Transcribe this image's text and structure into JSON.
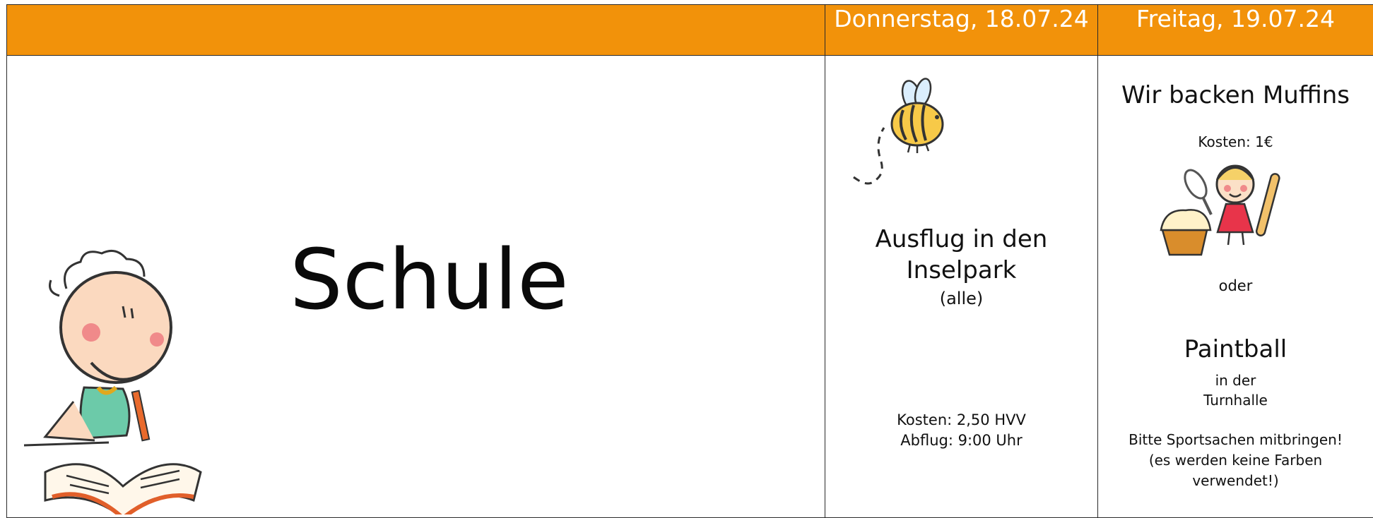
{
  "header": {
    "empty_label": "",
    "thursday": "Donnerstag, 18.07.24",
    "friday": "Freitag, 19.07.24"
  },
  "left": {
    "title": "Schule",
    "illustration_icon": "child-writing-icon"
  },
  "thursday": {
    "illustration_icon": "bee-icon",
    "title_line1": "Ausflug in den",
    "title_line2": "Inselpark",
    "subtitle": "(alle)",
    "cost": "Kosten: 2,50 HVV",
    "departure": "Abflug: 9:00 Uhr"
  },
  "friday": {
    "title": "Wir backen Muffins",
    "cost": "Kosten: 1€",
    "illustration_icon": "girl-baking-icon",
    "or": "oder",
    "alt_title": "Paintball",
    "location_line1": "in der",
    "location_line2": "Turnhalle",
    "note_line1": "Bitte Sportsachen mitbringen!",
    "note_line2": "(es werden keine Farben",
    "note_line3": "verwendet!)"
  },
  "colors": {
    "header_bg": "#f2920a",
    "header_text": "#ffffff",
    "border": "#2a2a2a"
  }
}
